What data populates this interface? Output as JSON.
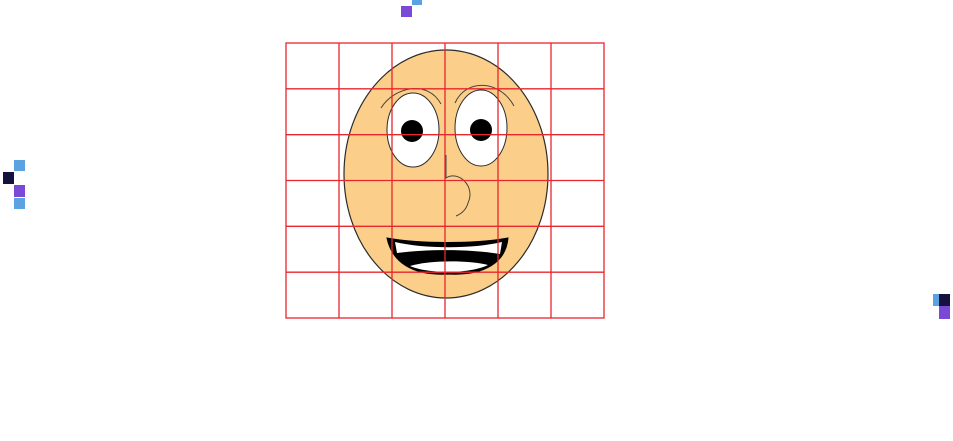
{
  "colors": {
    "background": "#ffffff",
    "grid_line": "#e8262d",
    "face_fill": "#fbcf8a",
    "face_stroke": "#2b2b2b",
    "eye_white": "#ffffff",
    "pupil": "#000000",
    "mouth_fill": "#000000",
    "teeth": "#ffffff",
    "deco_light_blue": "#5aa2e0",
    "deco_navy": "#15123f",
    "deco_purple": "#7a4ad6"
  },
  "grid": {
    "columns": 6,
    "rows": 6
  },
  "face": {
    "expression": "smiling",
    "features": [
      "eyebrows",
      "eyes",
      "nose",
      "mouth"
    ]
  },
  "decorations": [
    "pixel-cluster-top",
    "pixel-cluster-left",
    "pixel-cluster-right"
  ]
}
